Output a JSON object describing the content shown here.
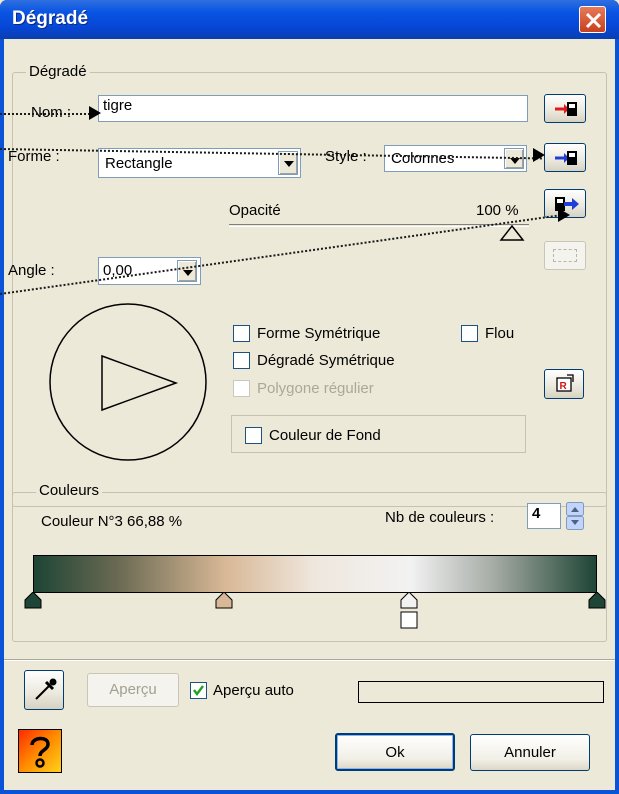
{
  "window": {
    "title": "Dégradé"
  },
  "group_gradient": {
    "legend": "Dégradé",
    "name_label": "Nom :",
    "name_value": "tigre",
    "forme_label": "Forme :",
    "forme_value": "Rectangle",
    "style_label": "Style :",
    "style_value": "Colonnes",
    "opacity_label": "Opacité",
    "opacity_value": "100 %",
    "angle_label": "Angle :",
    "angle_value": "0,00",
    "check_forme_sym": "Forme Symétrique",
    "check_flou": "Flou",
    "check_degrade_sym": "Dégradé Symétrique",
    "check_polygone": "Polygone régulier",
    "check_fond": "Couleur de Fond"
  },
  "group_colors": {
    "legend": "Couleurs",
    "current_color_label": "Couleur N°3 66,88 %",
    "count_label": "Nb de couleurs :",
    "count_value": "4"
  },
  "bottom": {
    "preview_button": "Aperçu",
    "auto_preview_label": "Aperçu auto",
    "ok_button": "Ok",
    "cancel_button": "Annuler"
  },
  "colors": {
    "title_bar": "#0a55e3",
    "gradient_dark": "#1e4535",
    "gradient_tan": "#d8b896",
    "gradient_light": "#f2f2f2",
    "arrow_red": "#e21a1a",
    "arrow_blue": "#1f3fd8"
  },
  "state": {
    "forme_symetrique_checked": false,
    "flou_checked": false,
    "degrade_symetrique_checked": false,
    "polygone_enabled": false,
    "couleur_fond_checked": false,
    "apercu_auto_checked": true,
    "opacity_percent": 100
  }
}
